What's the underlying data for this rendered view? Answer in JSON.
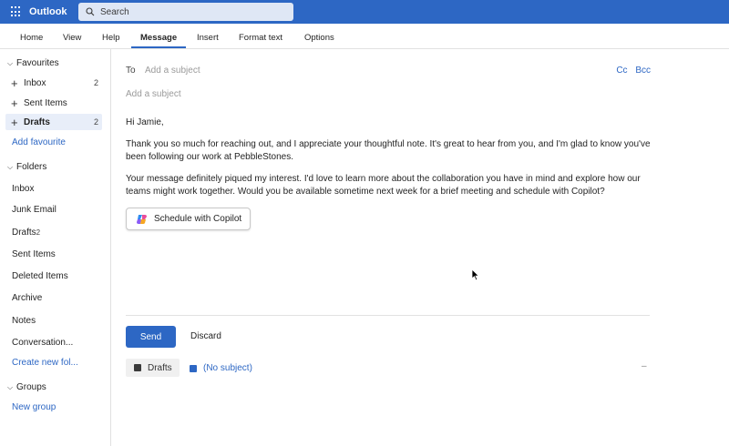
{
  "app": {
    "name": "Outlook"
  },
  "search": {
    "placeholder": "Search"
  },
  "ribbon": {
    "tabs": [
      "Home",
      "View",
      "Help",
      "Message",
      "Insert",
      "Format text",
      "Options"
    ],
    "active": "Message"
  },
  "sidebar": {
    "favourites_label": "Favourites",
    "favourites": [
      {
        "label": "Inbox",
        "count": "2"
      },
      {
        "label": "Sent Items",
        "count": ""
      },
      {
        "label": "Drafts",
        "count": "2"
      }
    ],
    "add_favourite": "Add favourite",
    "folders_label": "Folders",
    "folders": [
      {
        "label": "Inbox",
        "sup": ""
      },
      {
        "label": "Junk Email",
        "sup": ""
      },
      {
        "label": "Drafts",
        "sup": "2"
      },
      {
        "label": "Sent Items",
        "sup": ""
      },
      {
        "label": "Deleted Items",
        "sup": ""
      },
      {
        "label": "Archive",
        "sup": ""
      },
      {
        "label": "Notes",
        "sup": ""
      },
      {
        "label": "Conversation...",
        "sup": ""
      }
    ],
    "create_folder": "Create new fol...",
    "groups_label": "Groups",
    "new_group": "New group"
  },
  "compose": {
    "to_label": "To",
    "subject_placeholder_top": "Add a subject",
    "cc_label": "Cc",
    "bcc_label": "Bcc",
    "subject_placeholder": "Add a subject",
    "greeting": "Hi Jamie,",
    "paragraph1": "Thank you so much for reaching out, and I appreciate your thoughtful note. It's great to hear from you, and I'm glad to know you've been following our work at PebbleStones.",
    "paragraph2": "Your message definitely piqued my interest. I'd love to learn more about the collaboration you have in mind and explore how our teams might work together. Would you be available sometime next week for a brief meeting and schedule with Copilot?",
    "copilot_button": "Schedule with Copilot",
    "send_label": "Send",
    "discard_label": "Discard",
    "drafts_chip": "Drafts",
    "draft_title": "(No subject)",
    "minimize": "–"
  },
  "colors": {
    "brand": "#2d67c4",
    "draft_square": "#2d67c4",
    "drafts_chip_square": "#3b3b3b"
  },
  "icons": {
    "app_launcher": "waffle-icon",
    "search": "search-icon",
    "copilot": "copilot-icon",
    "pointer": "mouse-cursor-icon"
  }
}
